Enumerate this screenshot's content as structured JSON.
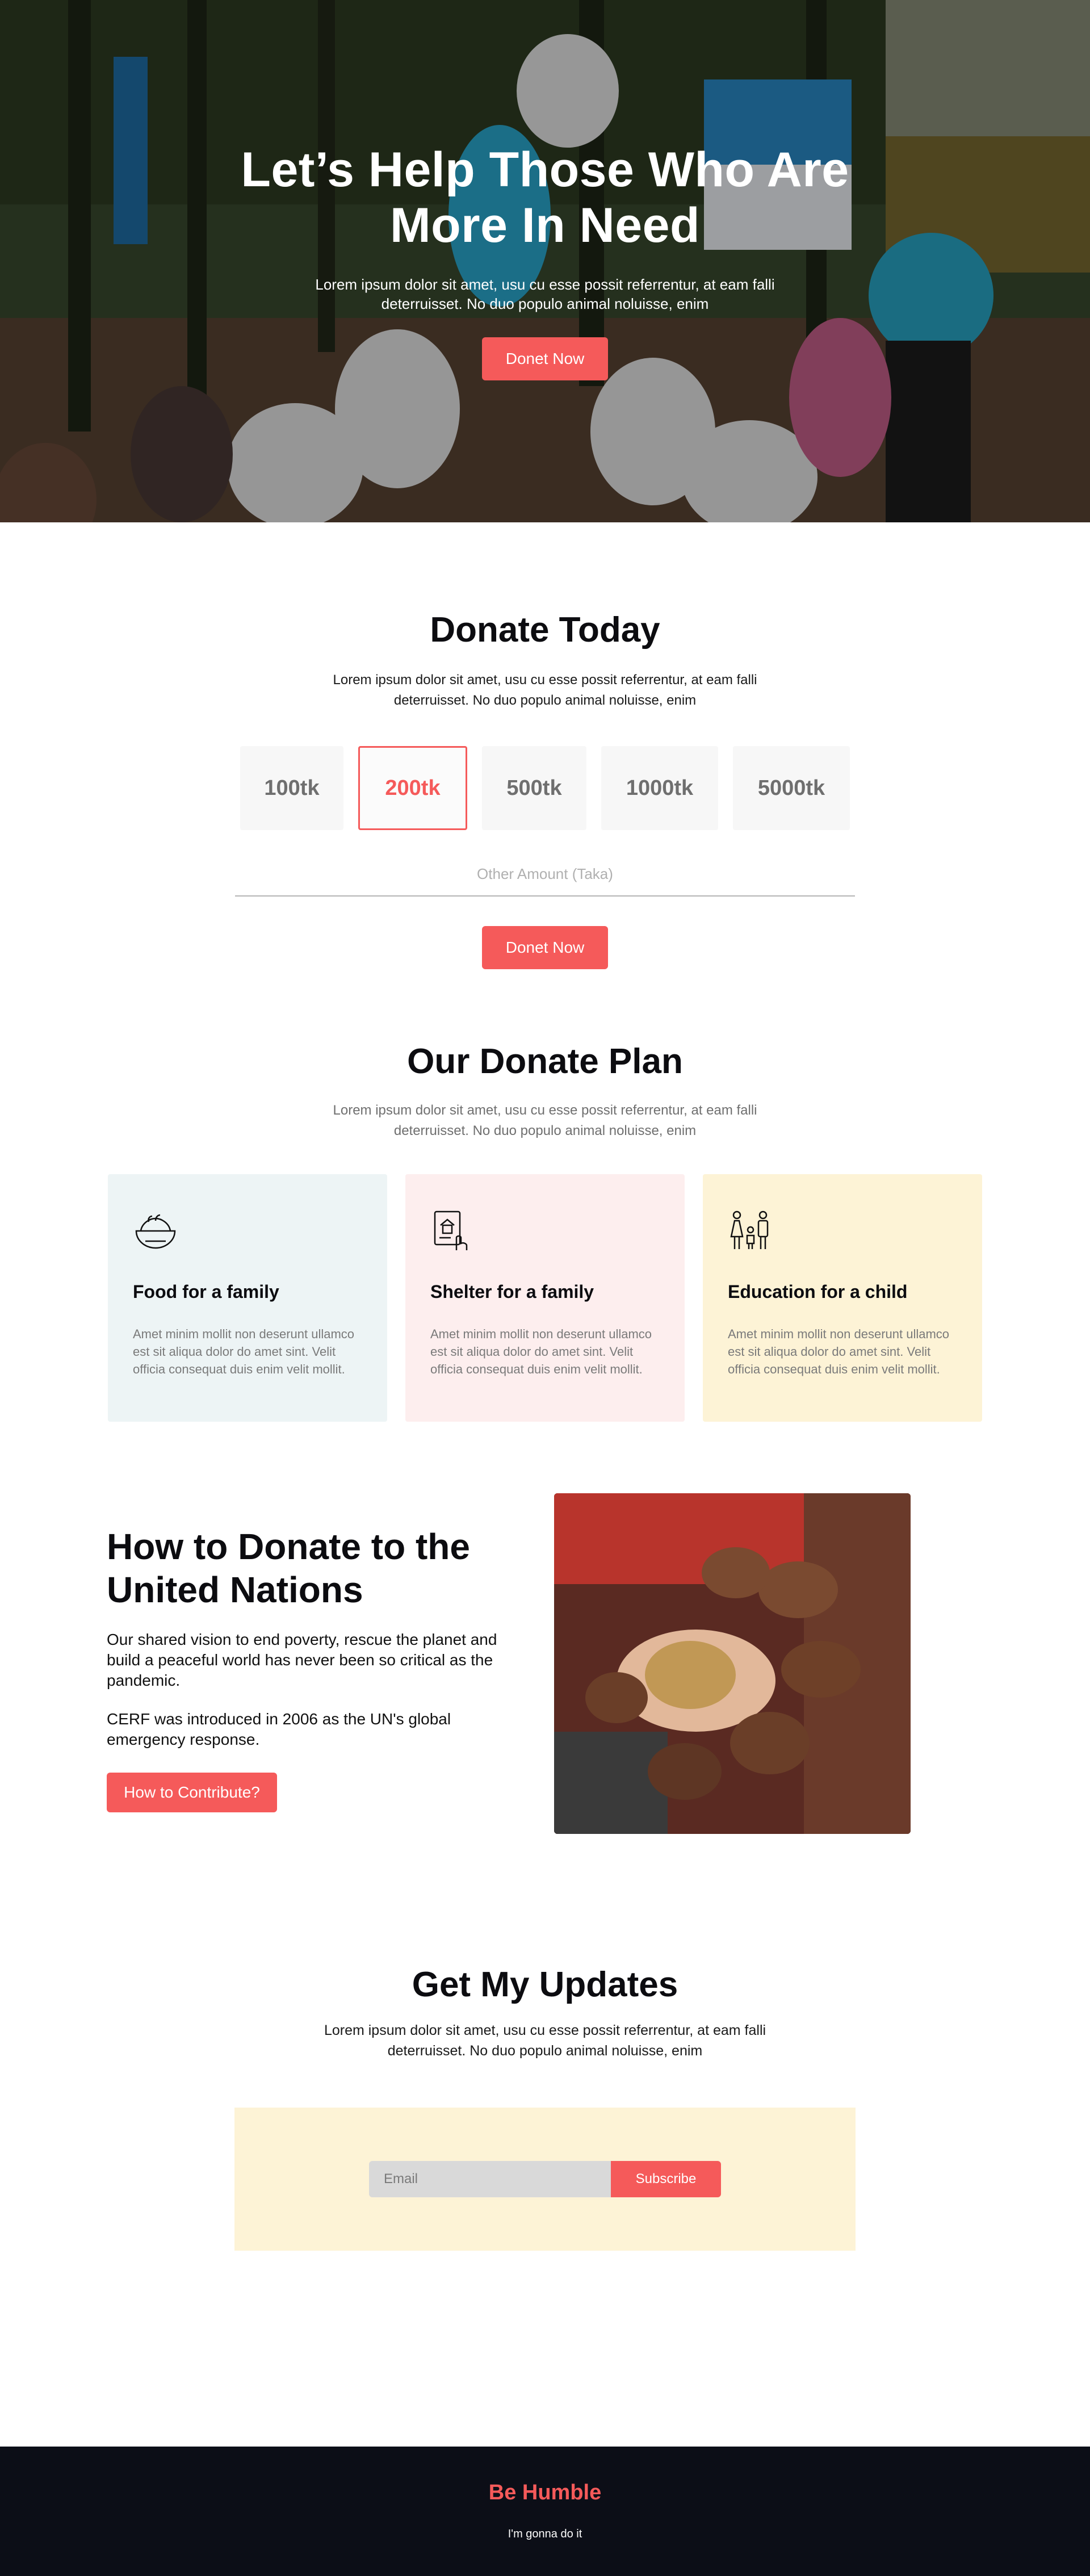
{
  "hero": {
    "title": "Let’s Help Those Who Are More In Need",
    "text": "Lorem ipsum dolor sit amet, usu cu esse possit referrentur, at eam falli deterruisset. No duo populo animal noluisse, enim",
    "button_label": "Donet Now"
  },
  "donate": {
    "title": "Donate Today",
    "text": "Lorem ipsum dolor sit amet, usu cu esse possit referrentur, at eam falli deterruisset. No duo populo animal noluisse, enim",
    "amounts": [
      "100tk",
      "200tk",
      "500tk",
      "1000tk",
      "5000tk"
    ],
    "selected_amount": "200tk",
    "other_amount_placeholder": "Other Amount (Taka)",
    "button_label": "Donet Now"
  },
  "plan": {
    "title": "Our Donate Plan",
    "text": "Lorem ipsum dolor sit amet, usu cu esse possit referrentur, at eam falli deterruisset. No duo populo animal noluisse, enim",
    "cards": [
      {
        "icon": "food-bowl-icon",
        "title": "Food for a family",
        "text": "Amet minim mollit non deserunt ullamco est sit aliqua dolor do amet sint. Velit officia consequat duis enim velit mollit.",
        "bg": "#edf4f5"
      },
      {
        "icon": "shelter-icon",
        "title": "Shelter for a family",
        "text": "Amet minim mollit non deserunt ullamco est sit aliqua dolor do amet sint. Velit officia consequat duis enim velit mollit.",
        "bg": "#fdeeee"
      },
      {
        "icon": "family-child-icon",
        "title": "Education for a child",
        "text": "Amet minim mollit non deserunt ullamco est sit aliqua dolor do amet sint. Velit officia consequat duis enim velit mollit.",
        "bg": "#fdf3d6"
      }
    ]
  },
  "how": {
    "title": "How to Donate to the United Nations",
    "paragraph1": "Our shared vision to end poverty, rescue the planet and build a peaceful world has never been so critical as the pandemic.",
    "paragraph2": "CERF was introduced in 2006 as the UN's global emergency response.",
    "button_label": "How to Contribute?"
  },
  "updates": {
    "title": "Get My Updates",
    "text": "Lorem ipsum dolor sit amet, usu cu esse possit referrentur, at eam falli deterruisset. No duo populo animal noluisse, enim",
    "email_placeholder": "Email",
    "subscribe_label": "Subscribe"
  },
  "footer": {
    "title": "Be Humble",
    "text": "I'm gonna do it"
  },
  "colors": {
    "accent": "#f55a5a",
    "footer_bg": "#0c0e17",
    "subscribe_bg": "#fdf3d6"
  }
}
